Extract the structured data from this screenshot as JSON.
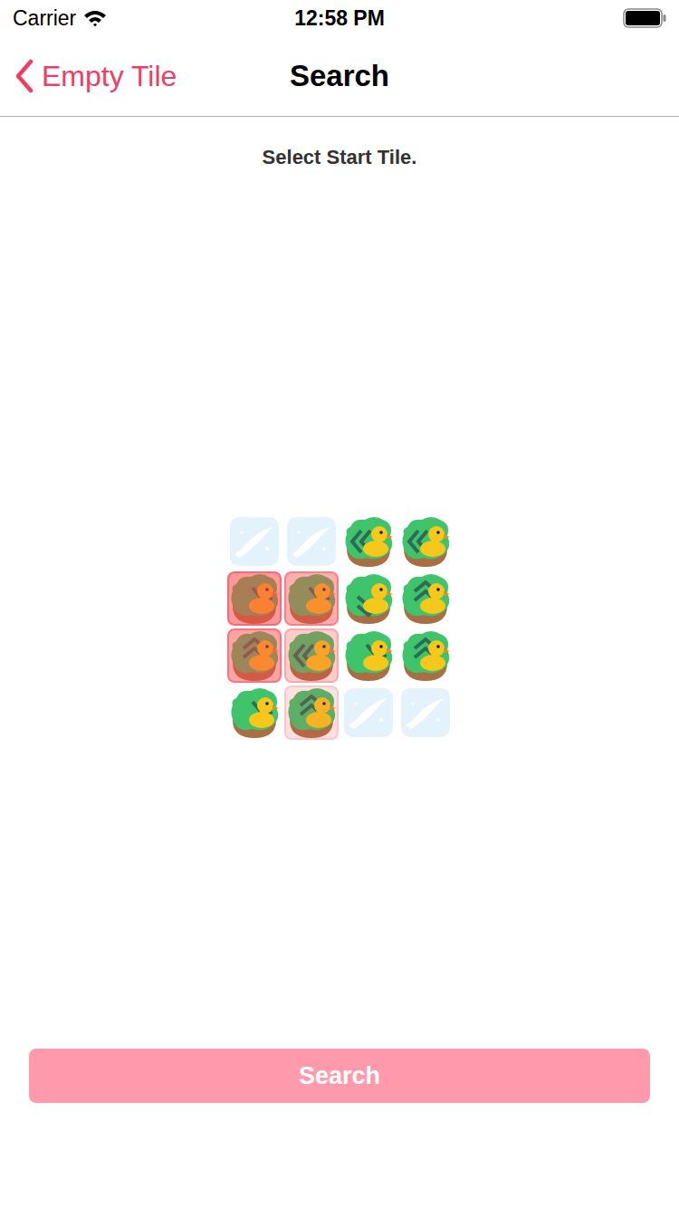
{
  "status_bar": {
    "carrier": "Carrier",
    "time": "12:58 PM",
    "battery_level": 1.0
  },
  "nav": {
    "back_label": "Empty Tile",
    "title": "Search"
  },
  "instruction": "Select Start Tile.",
  "board": {
    "rows": [
      [
        {
          "kind": "water",
          "highlight": 0
        },
        {
          "kind": "water",
          "highlight": 0
        },
        {
          "kind": "island",
          "direction": "left",
          "highlight": 0
        },
        {
          "kind": "island",
          "direction": "left",
          "highlight": 0
        }
      ],
      [
        {
          "kind": "island",
          "direction": "right",
          "highlight": 1
        },
        {
          "kind": "island",
          "direction": "right",
          "highlight": 0.8
        },
        {
          "kind": "island",
          "direction": "down",
          "highlight": 0
        },
        {
          "kind": "island",
          "direction": "up",
          "highlight": 0
        }
      ],
      [
        {
          "kind": "island",
          "direction": "up",
          "highlight": 0.9
        },
        {
          "kind": "island",
          "direction": "left",
          "highlight": 0.5
        },
        {
          "kind": "island",
          "direction": "right",
          "highlight": 0
        },
        {
          "kind": "island",
          "direction": "up",
          "highlight": 0
        }
      ],
      [
        {
          "kind": "island",
          "direction": "right",
          "highlight": 0
        },
        {
          "kind": "island",
          "direction": "up",
          "highlight": 0.3
        },
        {
          "kind": "water",
          "highlight": 0
        },
        {
          "kind": "water",
          "highlight": 0
        }
      ]
    ]
  },
  "search_button": {
    "label": "Search",
    "disabled": true
  }
}
